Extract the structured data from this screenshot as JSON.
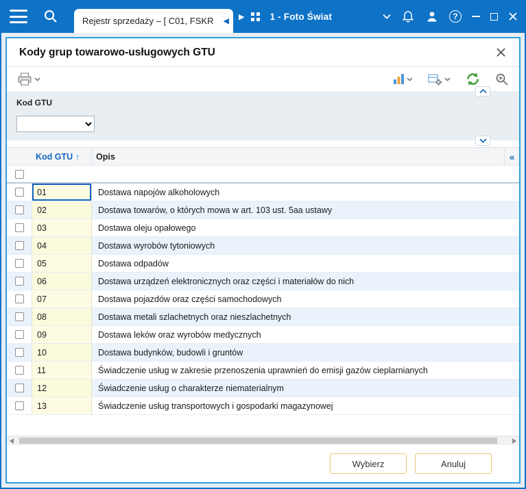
{
  "titlebar": {
    "tab_title": "Rejestr sprzedaży – [ C01, FSKR",
    "company": "1 - Foto Świat"
  },
  "dialog": {
    "title": "Kody grup towarowo-usługowych GTU",
    "filter_label": "Kod GTU",
    "filter_value": "",
    "table": {
      "columns": [
        "Kod GTU",
        "Opis"
      ],
      "sort_indicator": "↑",
      "rows": [
        {
          "kod": "01",
          "opis": "Dostawa napojów alkoholowych"
        },
        {
          "kod": "02",
          "opis": "Dostawa towarów, o których mowa w art. 103 ust. 5aa ustawy"
        },
        {
          "kod": "03",
          "opis": "Dostawa oleju opałowego"
        },
        {
          "kod": "04",
          "opis": "Dostawa wyrobów tytoniowych"
        },
        {
          "kod": "05",
          "opis": "Dostawa odpadów"
        },
        {
          "kod": "06",
          "opis": "Dostawa urządzeń elektronicznych oraz części i materiałów do nich"
        },
        {
          "kod": "07",
          "opis": "Dostawa pojazdów oraz części samochodowych"
        },
        {
          "kod": "08",
          "opis": "Dostawa metali szlachetnych oraz nieszlachetnych"
        },
        {
          "kod": "09",
          "opis": "Dostawa leków oraz wyrobów medycznych"
        },
        {
          "kod": "10",
          "opis": "Dostawa budynków, budowli i gruntów"
        },
        {
          "kod": "11",
          "opis": "Świadczenie usług w zakresie przenoszenia uprawnień do emisji gazów cieplarnianych"
        },
        {
          "kod": "12",
          "opis": "Świadczenie usług o charakterze niematerialnym"
        },
        {
          "kod": "13",
          "opis": "Świadczenie usług transportowych i gospodarki magazynowej"
        }
      ]
    },
    "buttons": {
      "select": "Wybierz",
      "cancel": "Anuluj"
    }
  },
  "colors": {
    "titlebar_blue": "#0e72c6",
    "dialog_border": "#2f9fe0",
    "accent_blue": "#1565c0",
    "row_alt_blue": "#eaf3fb",
    "kod_cell_yellow": "#fdfce2",
    "button_border_gold": "#e9c97c",
    "refresh_green": "#3f9c35"
  }
}
